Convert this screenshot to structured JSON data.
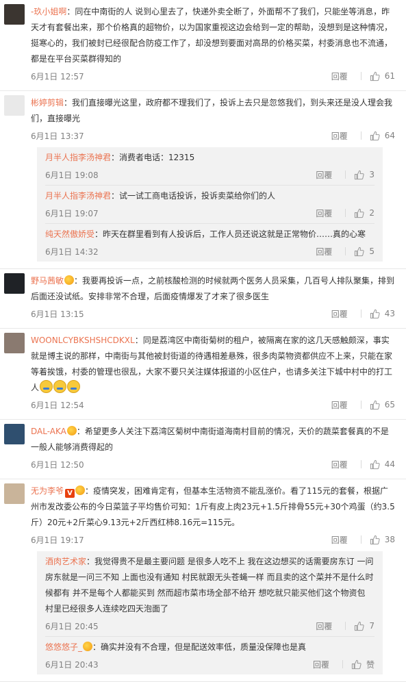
{
  "reply_label": "回覆",
  "colors": {
    "username": "#eb7350",
    "text": "#333333",
    "meta": "#808080",
    "sub_bg": "#f2f2f2"
  },
  "comments": [
    {
      "user": "-玖小姐啊",
      "text": "同在中南街的人 说到心里去了，快递外卖全断了，外面帮不了我们，只能坐等消息，昨天才有套餐出来，那个价格真的超物价，以为国家重视这边会给到一定的帮助，没想到是这种情况，挺寒心的，我们被封已经很配合防疫工作了，却没想到要面对高昂的价格买菜，村委消息也不流通，都是在平台买菜群得知的",
      "time": "6月1日 12:57",
      "likes": "61",
      "avatar_color": "#3b3530"
    },
    {
      "user": "彬婷剪辑",
      "text": "我们直接曝光这里，政府都不理我们了，投诉上去只是忽悠我们，到头来还是没人理会我们，直接曝光",
      "time": "6月1日 13:37",
      "likes": "64",
      "avatar_color": "#e9e9e9",
      "replies": [
        {
          "user": "月半人指李汤神君",
          "text": "消费者电话：12315",
          "time": "6月1日 19:08",
          "likes": "3"
        },
        {
          "user": "月半人指李汤神君",
          "text": "试一试工商电话投诉，投诉卖菜给你们的人",
          "time": "6月1日 19:07",
          "likes": "2"
        },
        {
          "user": "纯天然傲娇受",
          "text": "昨天在群里看到有人投诉后，工作人员还说这就是正常物价……真的心寒",
          "time": "6月1日 14:32",
          "likes": "5"
        }
      ]
    },
    {
      "user": "野马茜敏",
      "text": "我要再投诉一点，之前核酸检测的时候就两个医务人员采集，几百号人排队聚集，排到后面还没试纸。安排非常不合理，后面疫情爆发了才来了很多医生",
      "time": "6月1日 13:15",
      "likes": "43",
      "avatar_color": "#1f2226",
      "badge": true
    },
    {
      "user": "WOONLCYBKSHSHCDKXL",
      "text": "同是荔湾区中南街菊树的租户，被隔离在家的这几天感触颇深，事实就是博主说的那样，中南街与其他被封街道的待遇相差悬殊，很多肉菜物资都供应不上来，只能在家等着挨饿，村委的管理也很乱，大家不要只关注媒体报道的小区住户，也请多关注下城中村中的打工人",
      "time": "6月1日 12:54",
      "likes": "65",
      "avatar_color": "#8a7a70",
      "emojis": 3
    },
    {
      "user": "DAL-AKA",
      "text": "希望更多人关注下荔湾区菊树中南街道海南村目前的情况，天价的蔬菜套餐真的不是一般人能够消费得起的",
      "time": "6月1日 12:50",
      "likes": "44",
      "avatar_color": "#2f4f6f",
      "badge": true
    },
    {
      "user": "无为李爷",
      "text": "疫情突发，困难肯定有，但基本生活物资不能乱涨价。看了115元的套餐，根据广州市发改委公布的今日菜篮子平均售价可知：1斤有皮上肉23元+1.5斤排骨55元+30个鸡蛋（约3.5斤）20元+2斤菜心9.13元+2斤西红柿8.16元=115元。",
      "time": "6月1日 19:17",
      "likes": "38",
      "avatar_color": "#c9b49a",
      "vip": "V",
      "badge": true,
      "replies": [
        {
          "user": "酒肉艺术家",
          "text": "我觉得贵不是最主要问题 是很多人吃不上 我在这边想买的话需要房东订 一问房东就是一问三不知 上面也没有通知 村民就跟无头苍蝇一样 而且卖的这个菜并不是什么时候都有 并不是每个人都能买到 然而超市菜市场全部不给开 想吃就只能买他们这个物资包 村里已经很多人连续吃四天泡面了",
          "time": "6月1日 20:45",
          "likes": "7"
        },
        {
          "user": "悠悠悠子_",
          "text": "确实并没有不合理，但是配送效率低，质量没保障也是真",
          "time": "6月1日 20:43",
          "likes": "赞",
          "badge": true
        }
      ]
    }
  ]
}
